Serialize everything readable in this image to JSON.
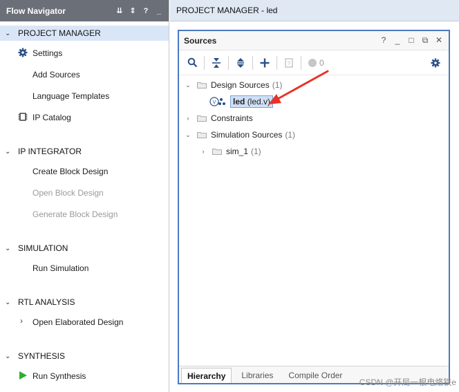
{
  "flow_navigator": {
    "title": "Flow Navigator",
    "sections": [
      {
        "label": "PROJECT MANAGER",
        "items": [
          {
            "label": "Settings",
            "icon": "gear-icon",
            "disabled": false
          },
          {
            "label": "Add Sources",
            "disabled": false
          },
          {
            "label": "Language Templates",
            "disabled": false
          },
          {
            "label": "IP Catalog",
            "icon": "ip-chip-icon",
            "disabled": false
          }
        ]
      },
      {
        "label": "IP INTEGRATOR",
        "items": [
          {
            "label": "Create Block Design",
            "disabled": false
          },
          {
            "label": "Open Block Design",
            "disabled": true
          },
          {
            "label": "Generate Block Design",
            "disabled": true
          }
        ]
      },
      {
        "label": "SIMULATION",
        "items": [
          {
            "label": "Run Simulation",
            "disabled": false
          }
        ]
      },
      {
        "label": "RTL ANALYSIS",
        "items": [
          {
            "label": "Open Elaborated Design",
            "disabled": false
          }
        ]
      },
      {
        "label": "SYNTHESIS",
        "items": [
          {
            "label": "Run Synthesis",
            "icon": "play-icon",
            "disabled": false
          }
        ]
      }
    ]
  },
  "header": {
    "title": "PROJECT MANAGER - led"
  },
  "sources": {
    "title": "Sources",
    "toolbar_count": "0",
    "tree": {
      "design_sources": {
        "label": "Design Sources",
        "count": "(1)"
      },
      "led": {
        "name": "led",
        "file": "(led.v)"
      },
      "constraints": {
        "label": "Constraints"
      },
      "simulation_sources": {
        "label": "Simulation Sources",
        "count": "(1)"
      },
      "sim_1": {
        "label": "sim_1",
        "count": "(1)"
      }
    },
    "tabs": [
      "Hierarchy",
      "Libraries",
      "Compile Order"
    ]
  },
  "watermark": "CSDN @开局一根电烙铁e",
  "colors": {
    "accent": "#4a78c2",
    "titlebar": "#6b6f78",
    "selection": "#cfe0f6",
    "arrow": "#e8332a",
    "play": "#2fae2f"
  }
}
